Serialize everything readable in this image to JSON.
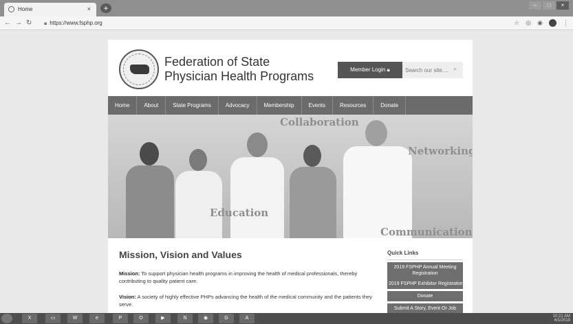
{
  "browser": {
    "tab_title": "Home",
    "tab_close": "×",
    "new_tab": "+",
    "url_prefix": "https://",
    "url_host": "www.fsphp.org",
    "win_min": "–",
    "win_max": "□",
    "win_close": "×"
  },
  "site": {
    "title": "Federation of State Physician Health Programs",
    "member_login": "Member Login",
    "search_placeholder": "Search our site....",
    "menu": [
      "Home",
      "About",
      "State Programs",
      "Advocacy",
      "Membership",
      "Events",
      "Resources",
      "Donate"
    ]
  },
  "hero": {
    "words": [
      "Collaboration",
      "Networking",
      "Education",
      "Communication"
    ]
  },
  "content": {
    "heading": "Mission, Vision and Values",
    "mission_label": "Mission:",
    "mission_text": "To support physician health programs in improving the health of medical professionals, thereby contributing to quality patient care.",
    "vision_label": "Vision:",
    "vision_text": "A society of highly effective PHPs advancing the health of the medical community and the patients they serve."
  },
  "quick_links": {
    "title": "Quick Links",
    "items": [
      "2019 FSPHP Annual Meeting Registration",
      "2019 FSPHP Exhibitor Registration",
      "Donate",
      "Submit A Story, Event Or Job"
    ]
  },
  "taskbar": {
    "time": "10:21 AM",
    "date": "4/1/2019"
  },
  "colors": {
    "nav_bar": "#6b6b6b",
    "button": "#555555",
    "page_bg": "#e9e9e9"
  }
}
